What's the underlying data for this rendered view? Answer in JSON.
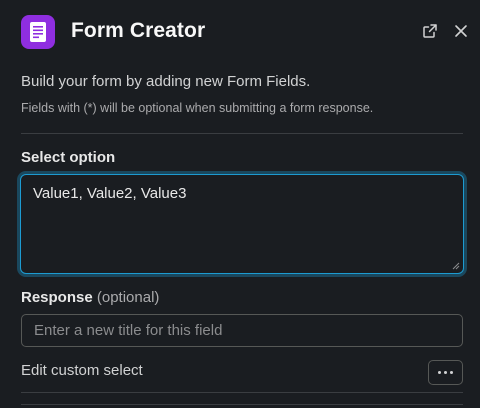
{
  "header": {
    "title": "Form Creator",
    "icon": "form-document-icon",
    "accent_color": "#8f2ee0"
  },
  "intro": {
    "text": "Build your form by adding new Form Fields.",
    "note": "Fields with (*) will be optional when submitting a form response."
  },
  "select_option": {
    "label": "Select option",
    "value": "Value1, Value2, Value3"
  },
  "response": {
    "label": "Response",
    "optional_label": "(optional)",
    "placeholder": "Enter a new title for this field"
  },
  "custom_select": {
    "label": "Edit custom select"
  },
  "colors": {
    "background": "#1a1d21",
    "focus": "#1d9bd1"
  }
}
